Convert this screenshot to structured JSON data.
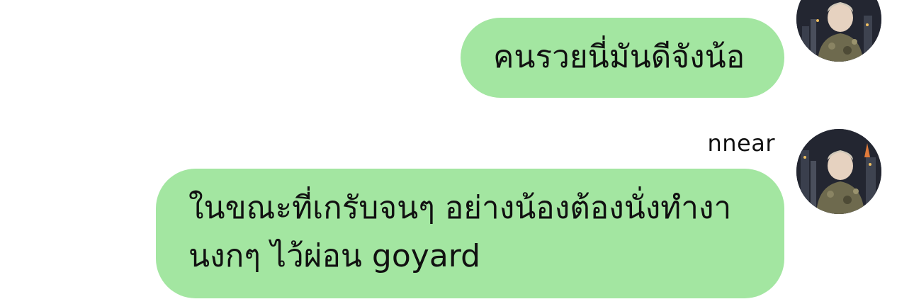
{
  "messages": [
    {
      "sender": "",
      "text": "คนรวยนี่มันดีจังน้อ"
    },
    {
      "sender": "nnear",
      "lines": [
        "ในขณะที่เกรับจนๆ อย่างน้องต้องนั่งทำงา",
        "นงกๆ ไว้ผ่อน goyard"
      ]
    }
  ],
  "colors": {
    "bubble": "#a3e6a1",
    "text": "#111111",
    "background": "#ffffff"
  },
  "icons": {
    "avatar": "user-avatar-photo"
  }
}
